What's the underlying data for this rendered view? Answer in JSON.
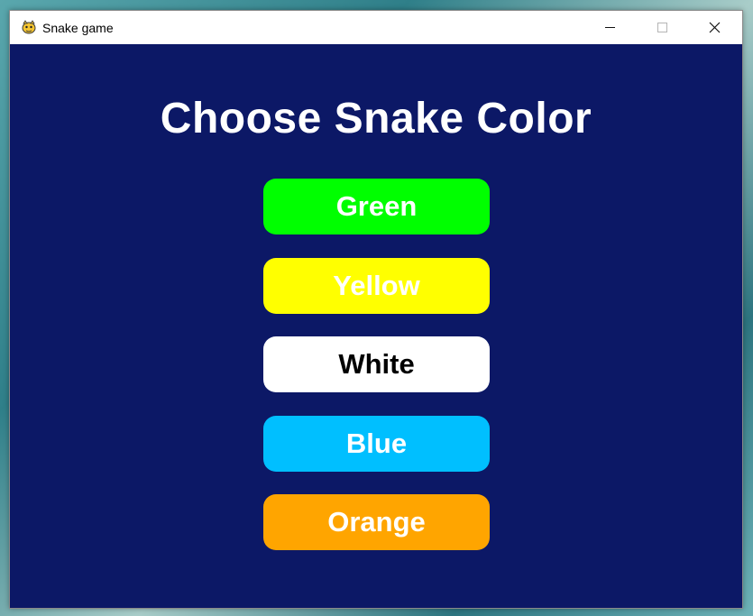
{
  "window": {
    "title": "Snake game",
    "app_icon": "pygame-snake-icon",
    "controls": {
      "minimize_icon": "minimize-icon",
      "maximize_icon": "maximize-icon",
      "close_icon": "close-icon"
    }
  },
  "menu": {
    "heading": "Choose Snake Color",
    "background_color": "#0c1866",
    "options": [
      {
        "label": "Green",
        "color": "#00ff00",
        "text_color": "#ffffff"
      },
      {
        "label": "Yellow",
        "color": "#ffff00",
        "text_color": "#ffffff"
      },
      {
        "label": "White",
        "color": "#ffffff",
        "text_color": "#000000"
      },
      {
        "label": "Blue",
        "color": "#00bfff",
        "text_color": "#ffffff"
      },
      {
        "label": "Orange",
        "color": "#ffa500",
        "text_color": "#ffffff"
      }
    ]
  }
}
